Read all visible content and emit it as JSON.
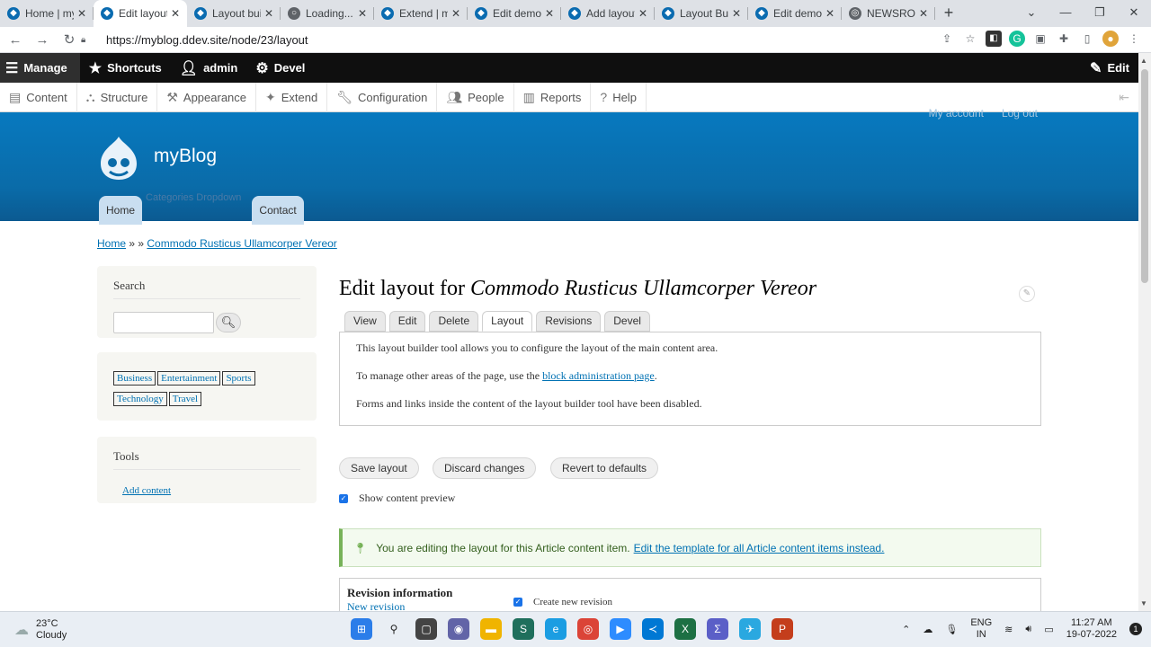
{
  "browser": {
    "tabs": [
      {
        "title": "Home | my",
        "active": false
      },
      {
        "title": "Edit layout",
        "active": true
      },
      {
        "title": "Layout buil",
        "active": false
      },
      {
        "title": "Loading...",
        "active": false
      },
      {
        "title": "Extend | my",
        "active": false
      },
      {
        "title": "Edit demo",
        "active": false
      },
      {
        "title": "Add layout",
        "active": false
      },
      {
        "title": "Layout Buil",
        "active": false
      },
      {
        "title": "Edit demo",
        "active": false
      },
      {
        "title": "NEWSROO",
        "active": false
      }
    ],
    "url": "https://myblog.ddev.site/node/23/layout"
  },
  "toolbar": {
    "manage": "Manage",
    "shortcuts": "Shortcuts",
    "user": "admin",
    "devel": "Devel",
    "edit": "Edit",
    "tray": [
      "Content",
      "Structure",
      "Appearance",
      "Extend",
      "Configuration",
      "People",
      "Reports",
      "Help"
    ]
  },
  "header": {
    "my_account": "My account",
    "log_out": "Log out",
    "site_name": "myBlog",
    "home": "Home",
    "categories": "Categories Dropdown",
    "contact": "Contact"
  },
  "breadcrumb": {
    "home": "Home",
    "sep": " » » ",
    "current": "Commodo Rusticus Ullamcorper Vereor"
  },
  "sidebar": {
    "search_title": "Search",
    "tags": [
      "Business",
      "Entertainment",
      "Sports",
      "Technology",
      "Travel"
    ],
    "tools_title": "Tools",
    "add_content": "Add content"
  },
  "main": {
    "title_prefix": "Edit layout for ",
    "title_node": "Commodo Rusticus Ullamcorper Vereor",
    "tabs": [
      "View",
      "Edit",
      "Delete",
      "Layout",
      "Revisions",
      "Devel"
    ],
    "active_tab": "Layout",
    "help1": "This layout builder tool allows you to configure the layout of the main content area.",
    "help2_pre": "To manage other areas of the page, use the ",
    "help2_link": "block administration page",
    "help2_post": ".",
    "help3": "Forms and links inside the content of the layout builder tool have been disabled.",
    "save": "Save layout",
    "discard": "Discard changes",
    "revert": "Revert to defaults",
    "show_preview": "Show content preview",
    "status_text": "You are editing the layout for this Article content item.",
    "status_link": "Edit the template for all Article content items instead.",
    "rev_title": "Revision information",
    "rev_sub": "New revision",
    "rev_create": "Create new revision"
  },
  "taskbar": {
    "temp": "23°C",
    "weather": "Cloudy",
    "lang1": "ENG",
    "lang2": "IN",
    "time": "11:27 AM",
    "date": "19-07-2022",
    "notifications": "1"
  }
}
